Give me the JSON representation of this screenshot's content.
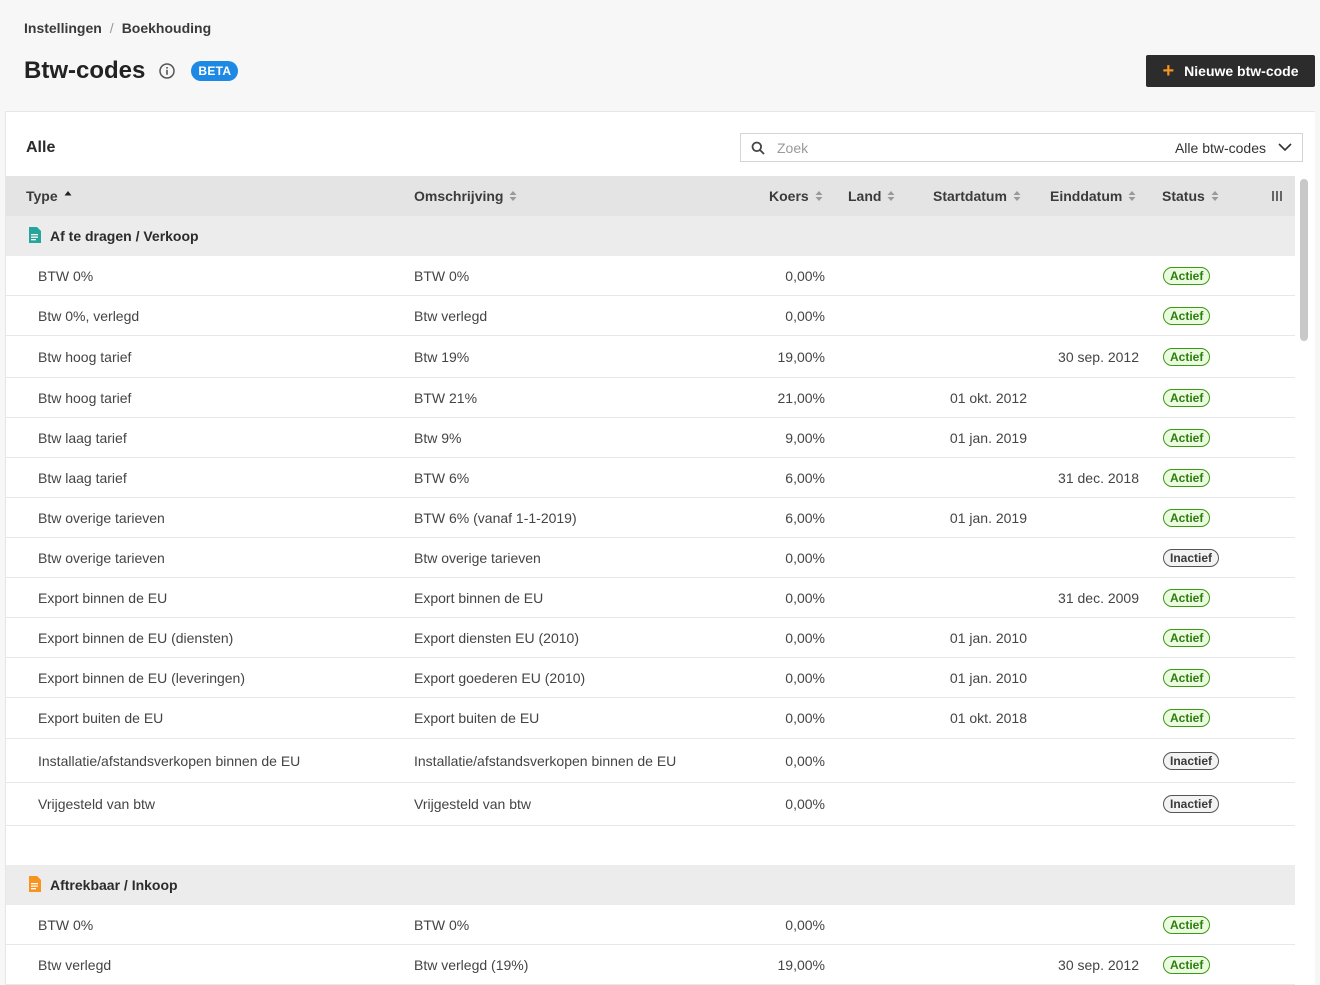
{
  "breadcrumb": {
    "parent": "Instellingen",
    "separator": "/",
    "current": "Boekhouding"
  },
  "page": {
    "title": "Btw-codes",
    "badge": "BETA"
  },
  "actions": {
    "new_label": "Nieuwe btw-code"
  },
  "panel": {
    "title": "Alle"
  },
  "search": {
    "placeholder": "Zoek",
    "filter_value": "Alle btw-codes"
  },
  "columns": {
    "type": "Type",
    "description": "Omschrijving",
    "rate": "Koers",
    "country": "Land",
    "start": "Startdatum",
    "end": "Einddatum",
    "status": "Status"
  },
  "groups": [
    {
      "label": "Af te dragen / Verkoop",
      "icon_color": "#26a69a",
      "rows": [
        {
          "type": "BTW 0%",
          "description": "BTW 0%",
          "rate": "0,00%",
          "start": "",
          "end": "",
          "status": "Actief"
        },
        {
          "type": "Btw 0%, verlegd",
          "description": "Btw verlegd",
          "rate": "0,00%",
          "start": "",
          "end": "",
          "status": "Actief"
        },
        {
          "type": "Btw hoog tarief",
          "description": "Btw 19%",
          "rate": "19,00%",
          "start": "",
          "end": "30 sep. 2012",
          "status": "Actief"
        },
        {
          "type": "Btw hoog tarief",
          "description": "BTW 21%",
          "rate": "21,00%",
          "start": "01 okt. 2012",
          "end": "",
          "status": "Actief"
        },
        {
          "type": "Btw laag tarief",
          "description": "Btw 9%",
          "rate": "9,00%",
          "start": "01 jan. 2019",
          "end": "",
          "status": "Actief"
        },
        {
          "type": "Btw laag tarief",
          "description": "BTW 6%",
          "rate": "6,00%",
          "start": "",
          "end": "31 dec. 2018",
          "status": "Actief"
        },
        {
          "type": "Btw overige tarieven",
          "description": "BTW 6% (vanaf 1-1-2019)",
          "rate": "6,00%",
          "start": "01 jan. 2019",
          "end": "",
          "status": "Actief"
        },
        {
          "type": "Btw overige tarieven",
          "description": "Btw overige tarieven",
          "rate": "0,00%",
          "start": "",
          "end": "",
          "status": "Inactief"
        },
        {
          "type": "Export binnen de EU",
          "description": "Export binnen de EU",
          "rate": "0,00%",
          "start": "",
          "end": "31 dec. 2009",
          "status": "Actief"
        },
        {
          "type": "Export binnen de EU (diensten)",
          "description": "Export diensten EU (2010)",
          "rate": "0,00%",
          "start": "01 jan. 2010",
          "end": "",
          "status": "Actief"
        },
        {
          "type": "Export binnen de EU (leveringen)",
          "description": "Export goederen EU (2010)",
          "rate": "0,00%",
          "start": "01 jan. 2010",
          "end": "",
          "status": "Actief"
        },
        {
          "type": "Export buiten de EU",
          "description": "Export buiten de EU",
          "rate": "0,00%",
          "start": "01 okt. 2018",
          "end": "",
          "status": "Actief"
        },
        {
          "type": "Installatie/afstandsverkopen binnen de EU",
          "description": "Installatie/afstandsverkopen binnen de EU",
          "rate": "0,00%",
          "start": "",
          "end": "",
          "status": "Inactief"
        },
        {
          "type": "Vrijgesteld van btw",
          "description": "Vrijgesteld van btw",
          "rate": "0,00%",
          "start": "",
          "end": "",
          "status": "Inactief"
        }
      ]
    },
    {
      "label": "Aftrekbaar / Inkoop",
      "icon_color": "#f7931e",
      "rows": [
        {
          "type": "BTW 0%",
          "description": "BTW 0%",
          "rate": "0,00%",
          "start": "",
          "end": "",
          "status": "Actief"
        },
        {
          "type": "Btw verlegd",
          "description": "Btw verlegd (19%)",
          "rate": "19,00%",
          "start": "",
          "end": "30 sep. 2012",
          "status": "Actief"
        }
      ]
    }
  ]
}
